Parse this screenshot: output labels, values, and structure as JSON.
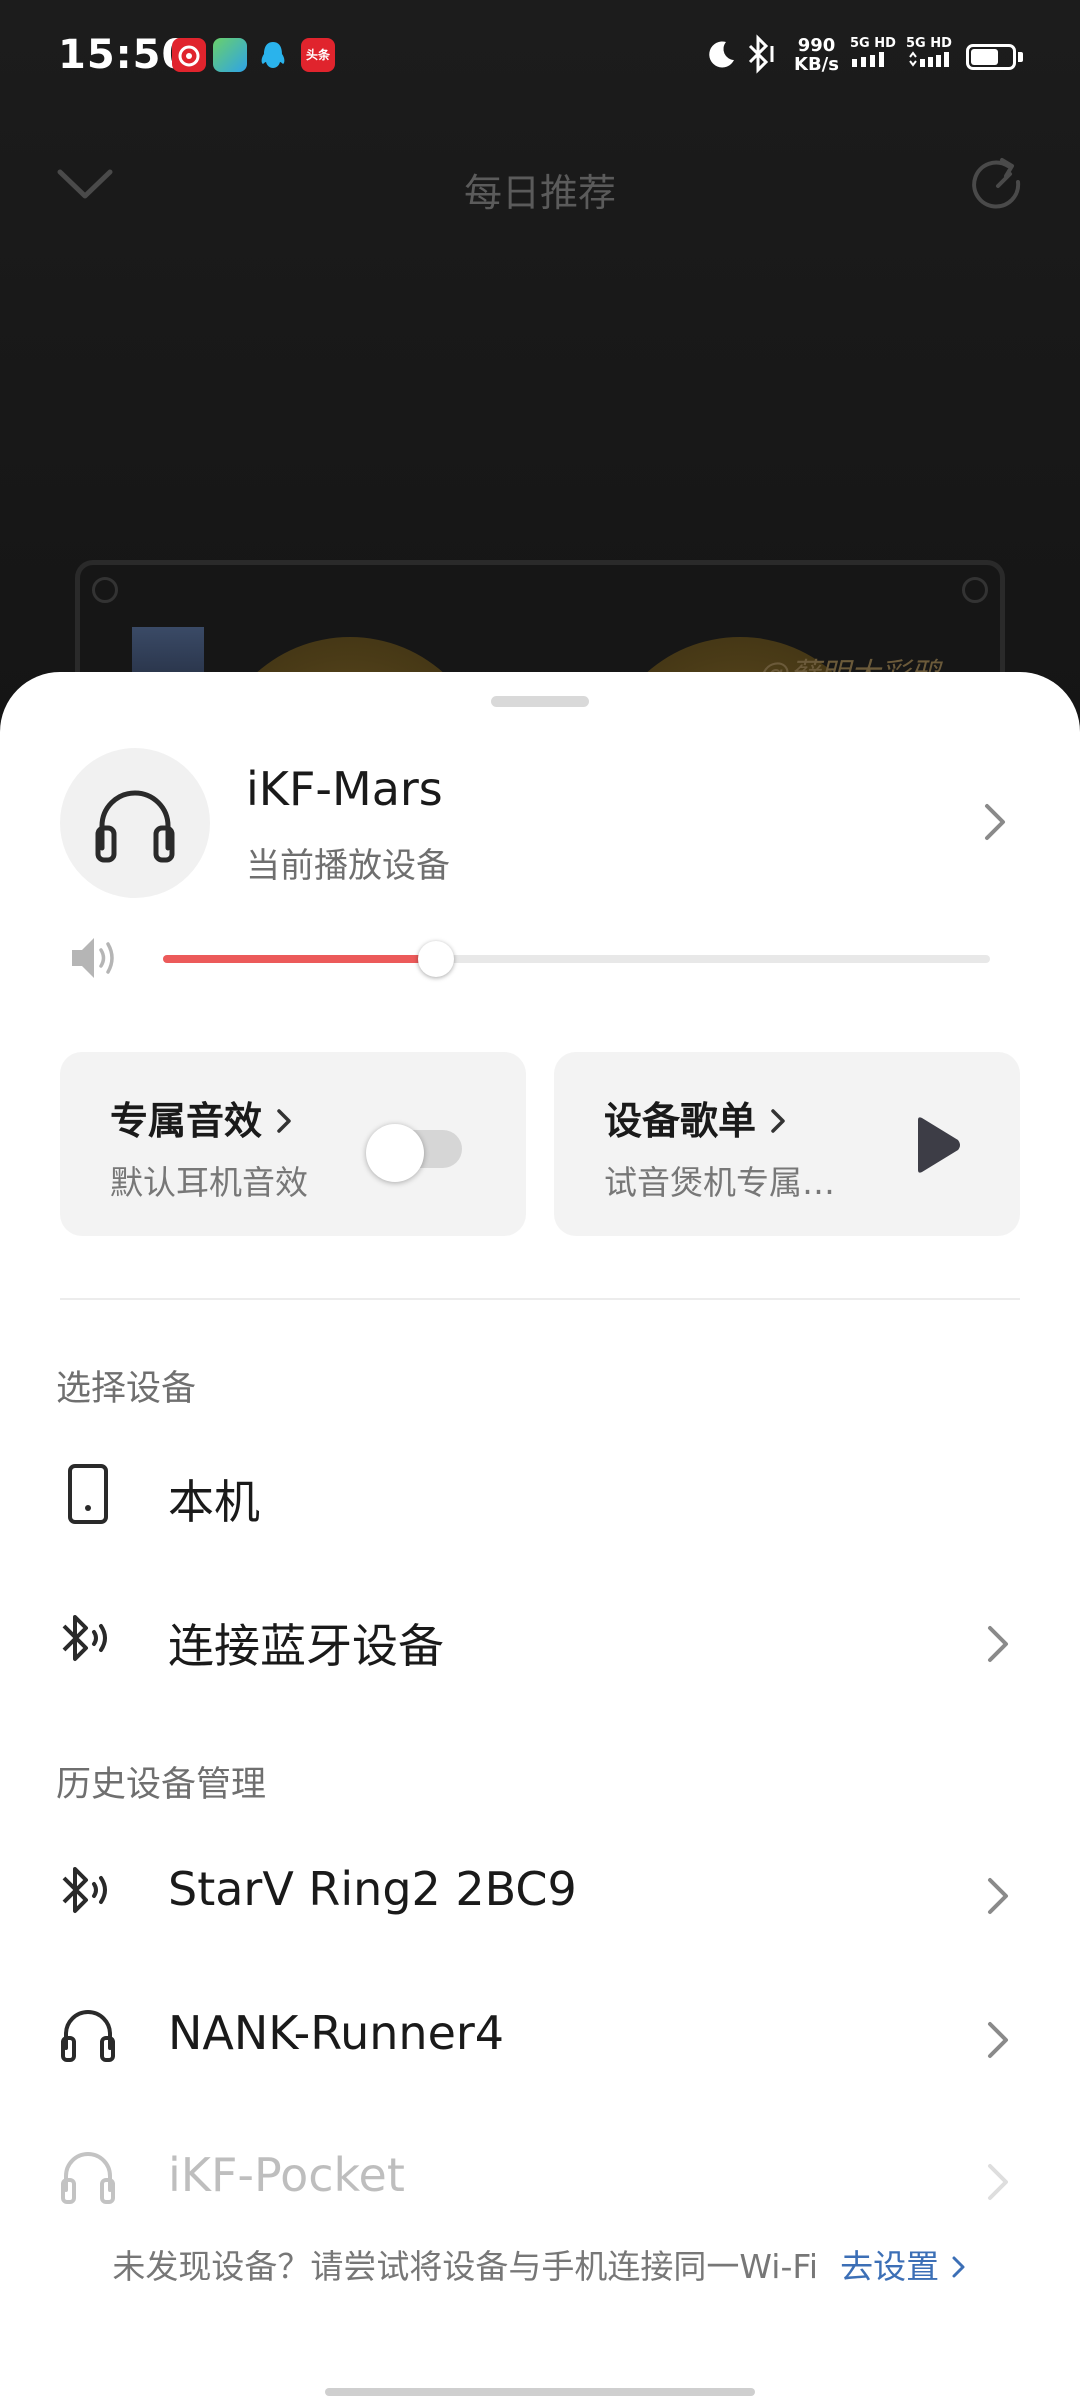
{
  "status_bar": {
    "time": "15:50",
    "net_speed_value": "990",
    "net_speed_unit": "KB/s",
    "signal_1": "5G HD",
    "signal_2": "5G HD",
    "battery_percent": 70,
    "app_icons": [
      "netease-music-icon",
      "photos-app-icon",
      "qq-icon",
      "toutiao-icon"
    ],
    "toutiao_label": "头条"
  },
  "player": {
    "title": "每日推荐",
    "watermark": "@藓明大彩鸦"
  },
  "sheet": {
    "current_device": {
      "name": "iKF-Mars",
      "subtitle": "当前播放设备"
    },
    "volume_fraction": 0.33,
    "cards": [
      {
        "title": "专属音效",
        "subtitle": "默认耳机音效",
        "toggle_on": false
      },
      {
        "title": "设备歌单",
        "subtitle": "试音煲机专属…"
      }
    ],
    "select_section": {
      "label": "选择设备",
      "items": [
        {
          "label": "本机",
          "icon": "phone-icon"
        },
        {
          "label": "连接蓝牙设备",
          "icon": "bluetooth-icon"
        }
      ]
    },
    "history_section": {
      "label": "历史设备管理",
      "items": [
        {
          "label": "StarV Ring2 2BC9",
          "icon": "bluetooth-icon"
        },
        {
          "label": "NANK-Runner4",
          "icon": "headphones-icon"
        },
        {
          "label": "iKF-Pocket",
          "icon": "headphones-icon"
        }
      ]
    },
    "footer": {
      "hint": "未发现设备？请尝试将设备与手机连接同一Wi-Fi",
      "link": "去设置"
    }
  },
  "colors": {
    "accent": "#ec5a5a",
    "link": "#3c6fb6",
    "background_dark": "#1b1b1b"
  }
}
